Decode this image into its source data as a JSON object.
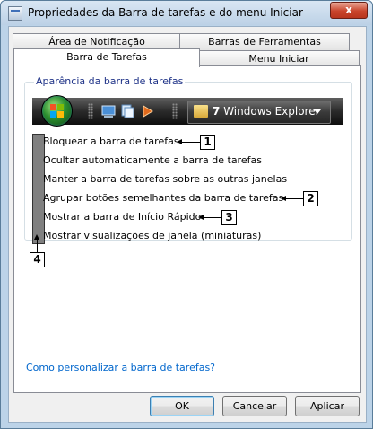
{
  "window": {
    "title": "Propriedades da Barra de tarefas e do menu Iniciar",
    "close_label": "x"
  },
  "tabs": {
    "notification_area": "Área de Notificação",
    "toolbars": "Barras de Ferramentas",
    "taskbar": "Barra de Tarefas",
    "start_menu": "Menu Iniciar",
    "active": "Barra de Tarefas"
  },
  "group": {
    "label": "Aparência da barra de tarefas"
  },
  "taskbar_preview": {
    "button_count": "7",
    "button_label": "Windows Explorer"
  },
  "options": [
    {
      "label": "Bloquear a barra de tarefas",
      "callout": "1"
    },
    {
      "label": "Ocultar automaticamente a barra de tarefas"
    },
    {
      "label": "Manter a barra de tarefas sobre as outras janelas"
    },
    {
      "label": "Agrupar botões semelhantes da barra de tarefas",
      "callout": "2"
    },
    {
      "label": "Mostrar a barra de Início Rápido",
      "callout": "3"
    },
    {
      "label": "Mostrar visualizações de janela (miniaturas)"
    }
  ],
  "bar_callout": "4",
  "help_link": "Como personalizar a barra de tarefas?",
  "buttons": {
    "ok": "OK",
    "cancel": "Cancelar",
    "apply": "Aplicar"
  },
  "colors": {
    "title_bar": "#bcd1e6",
    "close_button": "#c9442b",
    "link": "#0066cc",
    "group_label": "#1e3287",
    "taskbar": "#1a1a1a"
  }
}
